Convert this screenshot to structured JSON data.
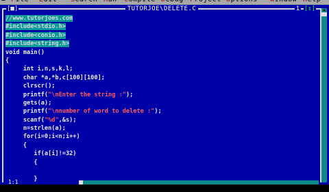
{
  "menubar": {
    "system": "≡",
    "items": [
      {
        "label": "File",
        "hot": "F"
      },
      {
        "label": "Edit",
        "hot": "E"
      },
      {
        "label": "Search",
        "hot": "S"
      },
      {
        "label": "Run",
        "hot": "R"
      },
      {
        "label": "Compile",
        "hot": "C"
      },
      {
        "label": "Debug",
        "hot": "D"
      },
      {
        "label": "Project",
        "hot": "P"
      },
      {
        "label": "Options",
        "hot": "O"
      },
      {
        "label": "Window",
        "hot": "W"
      },
      {
        "label": "Help",
        "hot": "H"
      }
    ]
  },
  "window": {
    "close": "[■]",
    "title": "TUTORJOE\\DELETE.C",
    "number": "1",
    "zoom": "[↕]"
  },
  "status": "1:1",
  "code": [
    {
      "text": "//www.tutorjoes.com",
      "selected": true
    },
    {
      "text": "#include<stdio.h>",
      "selected": true
    },
    {
      "text": "#include<conio.h>",
      "selected": true
    },
    {
      "text": "#include<string.h>",
      "selected": true
    },
    {
      "text": "void main()"
    },
    {
      "text": "{"
    },
    {
      "text": "     int i,n,s,k,l;"
    },
    {
      "text": "     char *a,*b,c[100][100];"
    },
    {
      "text": "     clrscr();"
    },
    {
      "pre": "     printf(",
      "str": "\"\\nEnter the string :\"",
      "post": ");"
    },
    {
      "text": "     gets(a);"
    },
    {
      "pre": "     printf(",
      "str": "\"\\nnumber of word to delete :\"",
      "post": ");"
    },
    {
      "pre": "     scanf(",
      "str": "\"%d\"",
      "post": ",&s);"
    },
    {
      "text": "     n=strlen(a);"
    },
    {
      "text": "     for(i=0;i<n;i++)"
    },
    {
      "text": "     {"
    },
    {
      "text": "        if(a[i]!=32)"
    },
    {
      "text": "        {"
    },
    {
      "text": ""
    },
    {
      "text": "        }"
    },
    {
      "text": ""
    }
  ]
}
